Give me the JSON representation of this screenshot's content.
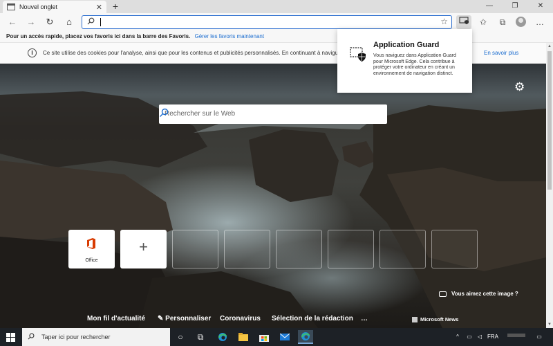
{
  "browser": {
    "tab_title": "Nouvel onglet",
    "tab_close": "✕",
    "new_tab": "+"
  },
  "window_controls": {
    "minimize": "—",
    "maximize": "❐",
    "close": "✕"
  },
  "toolbar": {
    "back": "←",
    "forward": "→",
    "refresh": "↻",
    "home": "⌂",
    "address_value": "",
    "favorite_star": "☆",
    "app_guard": "⧉",
    "favorites": "✩",
    "collections": "⧉",
    "more": "…"
  },
  "favorites_bar": {
    "text": "Pour un accès rapide, placez vos favoris ici dans la barre des Favoris.",
    "link": "Gérer les favoris maintenant"
  },
  "cookie_bar": {
    "info_icon": "i",
    "text": "Ce site utilise des cookies pour l'analyse, ainsi que pour les contenus et publicités personnalisés. En continuant à navigu",
    "learn_more": "En savoir plus"
  },
  "app_guard_popup": {
    "title": "Application Guard",
    "description": "Vous naviguez dans Application Guard pour Microsoft Edge. Cela contribue à protéger votre ordinateur en créant un environnement de navigation distinct."
  },
  "search": {
    "placeholder": "Rechercher sur le Web"
  },
  "quick_links": {
    "office_label": "Office",
    "add_symbol": "+"
  },
  "photo_credit": "Vous aimez cette image ?",
  "news_bar": {
    "items": [
      "Mon fil d'actualité",
      "Personnaliser",
      "Coronavirus",
      "Sélection de la rédaction",
      "…"
    ],
    "brand": "Microsoft News"
  },
  "taskbar": {
    "search_placeholder": "Taper ici pour rechercher",
    "language": "FRA",
    "tray_chevron": "^",
    "notifications": "▭"
  },
  "colors": {
    "accent": "#2d6fd0",
    "link": "#1a6ccf",
    "office_orange": "#d83b01",
    "taskbar": "#1d2126"
  }
}
